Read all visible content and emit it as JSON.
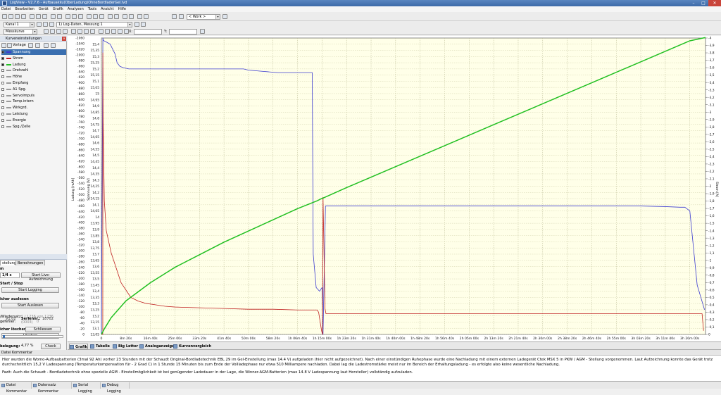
{
  "window": {
    "title": "LogView - V2.7.6 - Aufbauakku(OberLadung)OhneBordladerGel.lvd"
  },
  "menu": [
    "Datei",
    "Bearbeiten",
    "Gerät",
    "Grafik",
    "Analysen",
    "Tools",
    "Ansicht",
    "Hilfe"
  ],
  "toolbar": {
    "work_select": "< Work >",
    "channel_select": "Kanal 1",
    "log_select": "1) Log-Daten, Messung 1",
    "curve_select": "Messkurve",
    "x_label": "X:",
    "y_label": "Y:"
  },
  "curves_panel": {
    "title": "Kurveneinstellungen",
    "template_label": "Vorlage",
    "items": [
      {
        "name": "Spannung",
        "checked": true,
        "color": "#3b3bd0",
        "selected": true
      },
      {
        "name": "Strom",
        "checked": true,
        "color": "#c02020"
      },
      {
        "name": "Ladung",
        "checked": true,
        "color": "#22c022"
      },
      {
        "name": "Drehzahl",
        "checked": false,
        "color": "#9a9a9a"
      },
      {
        "name": "Höhe",
        "checked": false,
        "color": "#9a9a9a"
      },
      {
        "name": "Empfang",
        "checked": false,
        "color": "#9a9a9a"
      },
      {
        "name": "A1 Spg.",
        "checked": false,
        "color": "#9a9a9a"
      },
      {
        "name": "Servoimpuls",
        "checked": false,
        "color": "#9a9a9a"
      },
      {
        "name": "Temp.intern",
        "checked": false,
        "color": "#9a9a9a"
      },
      {
        "name": "Wirkgrd.",
        "checked": false,
        "color": "#9a9a9a"
      },
      {
        "name": "Leistung",
        "checked": false,
        "color": "#9a9a9a"
      },
      {
        "name": "Energie",
        "checked": false,
        "color": "#9a9a9a"
      },
      {
        "name": "Spg./Zelle",
        "checked": false,
        "color": "#9a9a9a"
      }
    ]
  },
  "device_panel": {
    "tabs": [
      "stellungen",
      "Berechnungen"
    ],
    "label_m": "m",
    "rate_value": "1/4 s",
    "start_live_button": "Start Live-Aufzeichnung",
    "start_stop_heading": "Start / Stop",
    "start_logging_button": "Start Logging",
    "read_heading": "icher auslesen",
    "start_read_button": "Start Auslesen",
    "playback_label": "/Wiedersatz:",
    "playback_value": "1 / 1236 von 1236 (0003)",
    "read_speed_label": "gefehler:",
    "read_speed_value": "0",
    "clear_heading": "icher löschen",
    "clear_button": "Löschen",
    "usage_label": "belegung:",
    "usage_value": "4,77 %",
    "check_button": "Check",
    "version_value": "V1.02",
    "serial_label": "Seriennr.:",
    "serial_value": "18702",
    "close_button": "Schliessen"
  },
  "bottom_tabs": [
    "Grafik",
    "Tabelle",
    "Big Letter",
    "Analoganzeige",
    "Kurvenvergleich"
  ],
  "comment": {
    "title": "Datei Kommentar",
    "text1": "Hier wurden die Womo-Aufbaubatterien (3mal 92 Ah) vorher 23 Stunden mit der Schaudt Original-Bordladetechnik EBL 29 im Gel-Einstellung (max 14.4 V) aufgeladen (hier nicht aufgezeichnet). Nach einer einstündigen Ruhephase wurde eine Nachladung mit einem externen Ladegerät Ctek MSX 5 in PKW / AGM - Stellung vorgenommen. Laut Aufzeichnung konnte das Gerät trotz durchschnittlich 15,2 V Ladespannung (Temperaturkompensation für - 2 Grad C) in 1 Stunde 15 Minuten bis zum Ende der Vollladephase nur etwa 510 Milliampere nachladen. Dabei lag die Ladestromstärke meist nur im Bereich der Erhaltungsladung - es erfolgte also keine wesentliche Nachladung.",
    "text2": "Fazit: Auch die Schaudt - Bordladetechnik ohne spezielle AGM - Einstellmöglichkeit ist bei genügender Ladedauer in der Lage, die Winner-AGM-Batterien (max 14.8 V Ladespannung laut Hersteller) vollständig aufzuladen."
  },
  "status_tabs": [
    "Datei Kommentar",
    "Datensatz Kommentar",
    "Serial Logging",
    "Debug Logging"
  ],
  "chart_data": {
    "type": "line",
    "x_unit": "time",
    "x_ticks": [
      "0",
      "8m 20s",
      "16m 40s",
      "25m 00s",
      "33m 20s",
      "41m 40s",
      "50m 00s",
      "58m 20s",
      "1h 06m 40s",
      "1h 15m 00s",
      "1h 23m 20s",
      "1h 31m 40s",
      "1h 40m 00s",
      "1h 48m 20s",
      "1h 56m 40s",
      "2h 05m 00s",
      "2h 13m 20s",
      "2h 21m 40s",
      "2h 30m 00s",
      "2h 38m 20s",
      "2h 46m 40s",
      "2h 55m 00s",
      "3h 03m 20s",
      "3h 11m 40s",
      "3h 20m 00s"
    ],
    "x_ticks_seconds": [
      0,
      500,
      1000,
      1500,
      2000,
      2500,
      3000,
      3500,
      4000,
      4500,
      5000,
      5500,
      6000,
      6500,
      7000,
      7500,
      8000,
      8500,
      9000,
      9500,
      10000,
      10500,
      11000,
      11500,
      12000
    ],
    "xlim_seconds": [
      0,
      12320
    ],
    "left_axis1": {
      "label": "Ladung [mAh]",
      "range": [
        0,
        -1060
      ],
      "ticks": [
        -1060,
        -1040,
        -1020,
        -1000,
        -980,
        -960,
        -940,
        -920,
        -900,
        -880,
        -860,
        -840,
        -820,
        -800,
        -780,
        -760,
        -740,
        -720,
        -700,
        -680,
        -660,
        -640,
        -620,
        -600,
        -580,
        -560,
        -540,
        -520,
        -500,
        -480,
        -460,
        -440,
        -420,
        -400,
        -380,
        -360,
        -340,
        -320,
        -300,
        -280,
        -260,
        -240,
        -220,
        -200,
        -180,
        -160,
        -140,
        -120,
        -100,
        -80,
        -60,
        -40,
        -20,
        0
      ]
    },
    "left_axis2": {
      "label": "Spannung [V]",
      "range": [
        13.05,
        15.45
      ],
      "ticks": [
        15.4,
        15.35,
        15.3,
        15.25,
        15.2,
        15.15,
        15.1,
        15.05,
        15,
        14.95,
        14.9,
        14.85,
        14.8,
        14.75,
        14.7,
        14.65,
        14.6,
        14.55,
        14.5,
        14.45,
        14.4,
        14.35,
        14.3,
        14.25,
        14.2,
        14.15,
        14.1,
        14.05,
        14,
        13.95,
        13.9,
        13.85,
        13.8,
        13.75,
        13.7,
        13.65,
        13.6,
        13.55,
        13.5,
        13.45,
        13.4,
        13.35,
        13.3,
        13.25,
        13.2,
        13.15,
        13.1,
        13.05
      ]
    },
    "right_axis": {
      "label": "Strom [A]",
      "range": [
        0,
        -4
      ],
      "ticks": [
        -4,
        -3.9,
        -3.8,
        -3.7,
        -3.6,
        -3.5,
        -3.4,
        -3.3,
        -3.2,
        -3.1,
        -3,
        -2.9,
        -2.8,
        -2.7,
        -2.6,
        -2.5,
        -2.4,
        -2.3,
        -2.2,
        -2.1,
        -2,
        -1.9,
        -1.8,
        -1.7,
        -1.6,
        -1.5,
        -1.4,
        -1.3,
        -1.2,
        -1.1,
        -1,
        -0.9,
        -0.8,
        -0.7,
        -0.6,
        -0.5,
        -0.4,
        -0.3,
        -0.2,
        -0.1,
        0
      ]
    },
    "grid": true,
    "series": [
      {
        "name": "Spannung",
        "axis": "voltage",
        "color": "#3b3bd0",
        "x": [
          0,
          30,
          40,
          90,
          180,
          280,
          320,
          380,
          450,
          560,
          700,
          1000,
          1500,
          2000,
          2500,
          2900,
          3000,
          3300,
          3600,
          3900,
          4200,
          4300,
          4320,
          4380,
          4450,
          4500,
          4520,
          4570,
          5000,
          6000,
          7000,
          8000,
          9000,
          10000,
          11000,
          11500,
          11800,
          11900,
          12000,
          12150,
          12300
        ],
        "y": [
          13.05,
          15.45,
          15.43,
          15.42,
          15.4,
          15.32,
          15.25,
          15.22,
          15.21,
          15.2,
          15.2,
          15.2,
          15.2,
          15.2,
          15.2,
          15.2,
          15.19,
          15.18,
          15.17,
          15.17,
          15.17,
          15.17,
          13.7,
          13.43,
          13.4,
          13.43,
          13.05,
          14.09,
          14.09,
          14.09,
          14.09,
          14.09,
          14.09,
          14.09,
          14.09,
          14.085,
          14.08,
          14.08,
          14.05,
          13.45,
          13.25
        ]
      },
      {
        "name": "Strom",
        "axis": "current",
        "color": "#c02020",
        "x": [
          0,
          28,
          30,
          35,
          60,
          100,
          200,
          300,
          400,
          500,
          600,
          750,
          900,
          1100,
          1300,
          1500,
          2000,
          2500,
          3000,
          3500,
          4000,
          4400,
          4430,
          4490,
          4510,
          4520,
          4560,
          4580,
          5000,
          7000,
          9000,
          11000,
          12000,
          12250,
          12280
        ],
        "y": [
          0,
          0,
          -3.8,
          -2.9,
          -1.8,
          -1.4,
          -1.1,
          -0.9,
          -0.7,
          -0.6,
          -0.5,
          -0.45,
          -0.42,
          -0.4,
          -0.38,
          -0.37,
          -0.36,
          -0.35,
          -0.34,
          -0.34,
          -0.33,
          -0.33,
          -0.3,
          -0.05,
          0,
          -1.85,
          -0.35,
          -0.28,
          -0.28,
          -0.28,
          -0.28,
          -0.28,
          -0.28,
          -0.28,
          -0.05
        ]
      },
      {
        "name": "Ladung",
        "axis": "charge",
        "color": "#22c022",
        "x": [
          0,
          60,
          200,
          500,
          1000,
          1500,
          2000,
          2500,
          3000,
          3500,
          4000,
          4400,
          4480,
          4550,
          5000,
          6000,
          7000,
          8000,
          9000,
          10000,
          11000,
          12000,
          12320
        ],
        "y": [
          0,
          -20,
          -60,
          -120,
          -185,
          -240,
          -285,
          -330,
          -370,
          -410,
          -450,
          -478,
          -485,
          -490,
          -525,
          -600,
          -675,
          -750,
          -825,
          -900,
          -975,
          -1050,
          -1062
        ]
      }
    ]
  }
}
